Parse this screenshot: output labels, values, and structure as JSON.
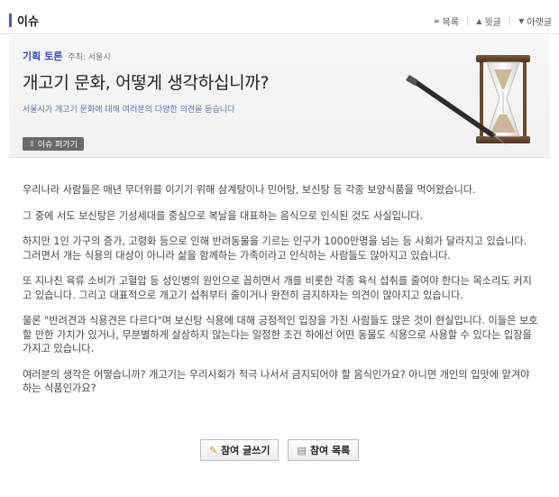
{
  "header": {
    "section_title": "이슈",
    "nav": [
      {
        "icon": "list-icon",
        "glyph": "≡",
        "label": "목록"
      },
      {
        "icon": "up-arrow-icon",
        "glyph": "▲",
        "label": "윗글"
      },
      {
        "icon": "down-arrow-icon",
        "glyph": "▼",
        "label": "아랫글"
      }
    ]
  },
  "banner": {
    "tag": "기획 토론",
    "host": "주최: 서울시",
    "title": "개고기 문화, 어떻게 생각하십니까?",
    "subtitle": "서울시가 개고기 문화에 대해 여러분의 다양한 의견을 듣습니다",
    "share_button": "이슈 퍼가기",
    "share_icon": "share-icon",
    "illustration": "hourglass-pen-illustration"
  },
  "body": {
    "paragraphs": [
      "우리나라 사람들은 매년 무더위를 이기기 위해 삼계탕이나 민어탕, 보신탕 등 각종 보양식품을 먹어왔습니다.",
      "그 중에 서도 보신탕은 기성세대를 중심으로 복날을 대표하는 음식으로 인식된 것도 사실입니다.",
      "하지만 1인 가구의 증가, 고령화 등으로 인해 반려동물을 기르는 인구가 1000만명을 넘는 등 사회가 달라지고 있습니다. 그러면서 개는 식용의 대상이 아니라 삶을 함께하는 가족이라고 인식하는 사람들도 많아지고 있습니다.",
      "또 지나친 육류 소비가 고혈압 등 성인병의 원인으로 꼽히면서 개를 비롯한 각종 육식 섭취를 줄여야 한다는 목소리도 커지고 있습니다. 그리고 대표적으로 개고기 섭취부터 줄이거나 완전히 금지하자는 의견이 많아지고 있습니다.",
      "물론 \"반려견과 식용견은 다르다\"며 보신탕 식용에 대해 긍정적인 입장을 가진 사람들도 많은 것이 현실입니다. 이들은 보호할 만한 가치가 있거나, 무분별하게 살상하지 않는다는 일정한 조건 하에선 어떤 동물도 식용으로 사용할 수 있다는 입장을 가지고 있습니다.",
      "여러분의 생각은 어떻습니까? 개고기는 우리사회가 적극 나서서 금지되어야 할 음식인가요? 아니면 개인의 입맛에 맡겨야 하는 식품인가요?"
    ]
  },
  "actions": {
    "write_button": "참여 글쓰기",
    "write_icon": "pen-icon",
    "list_button": "참여 목록",
    "list_icon": "list-box-icon"
  },
  "colors": {
    "accent": "#4a55c4",
    "subtitle": "#5b6fc0",
    "share_button_bg": "#6a6a6a"
  }
}
